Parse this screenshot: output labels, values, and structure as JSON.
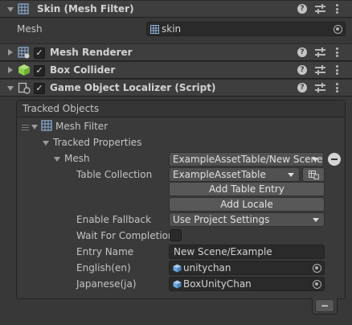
{
  "header_mesh_filter": {
    "title": "Skin (Mesh Filter)"
  },
  "mesh_row": {
    "label": "Mesh",
    "value": "skin"
  },
  "components": [
    {
      "title": "Mesh Renderer",
      "enabled": true
    },
    {
      "title": "Box Collider",
      "enabled": true
    },
    {
      "title": "Game Object Localizer (Script)",
      "enabled": true
    }
  ],
  "localizer": {
    "tracked_objects_label": "Tracked Objects",
    "mesh_filter_label": "Mesh Filter",
    "tracked_properties_label": "Tracked Properties",
    "mesh_label": "Mesh",
    "mesh_popup_value": "ExampleAssetTable/New Scene",
    "table_collection_label": "Table Collection",
    "table_collection_value": "ExampleAssetTable",
    "add_table_entry_label": "Add Table Entry",
    "add_locale_label": "Add Locale",
    "enable_fallback_label": "Enable Fallback",
    "enable_fallback_value": "Use Project Settings",
    "wait_for_completion_label": "Wait For Completion",
    "wait_for_completion_checked": false,
    "entry_name_label": "Entry Name",
    "entry_name_value": "New Scene/Example",
    "english_label": "English(en)",
    "english_value": "unitychan",
    "japanese_label": "Japanese(ja)",
    "japanese_value": "BoxUnityChan",
    "remove_label": "−"
  },
  "icons": {
    "help": "?",
    "check": "✓"
  },
  "colors": {
    "background": "#383838",
    "header": "#3e3e3e",
    "field": "#2a2a2a",
    "button": "#585858",
    "collider_green": "#8fd14f",
    "cube_blue": "#6fa8dc"
  }
}
